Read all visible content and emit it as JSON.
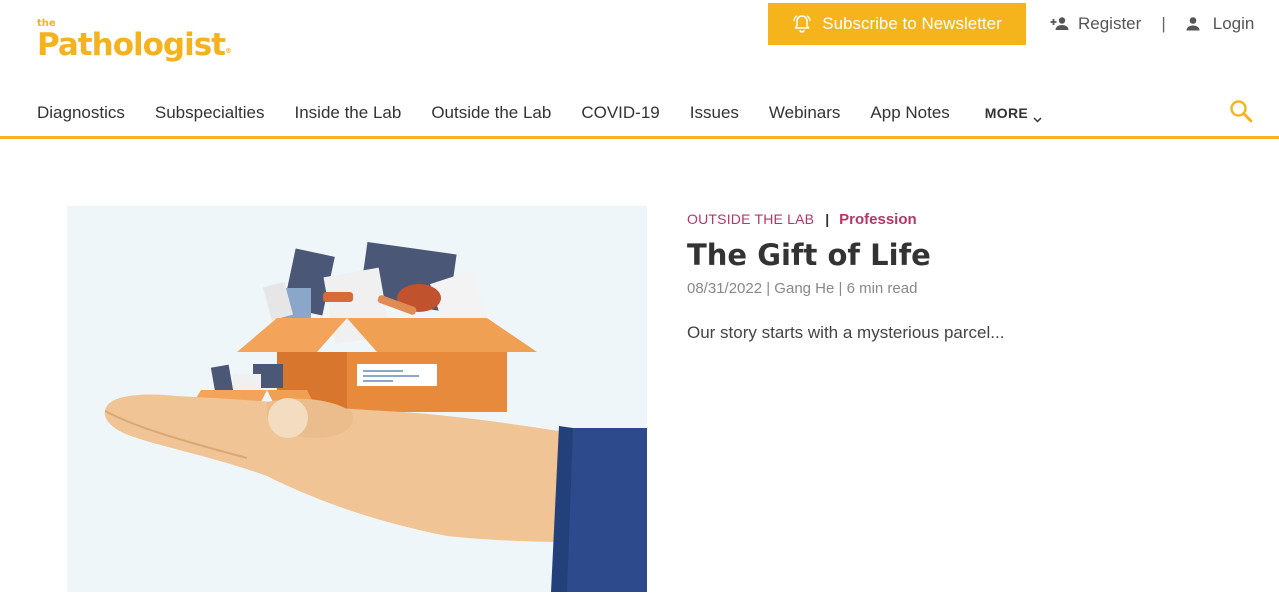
{
  "logo": {
    "the": "the",
    "name": "Pathologist",
    "mark": "®"
  },
  "header": {
    "subscribe_label": "Subscribe to Newsletter",
    "register_label": "Register",
    "separator": "|",
    "login_label": "Login",
    "icons": {
      "subscribe": "bell-icon",
      "register": "add-user-icon",
      "login": "user-icon",
      "search": "search-icon"
    }
  },
  "nav": {
    "items": [
      "Diagnostics",
      "Subspecialties",
      "Inside the Lab",
      "Outside the Lab",
      "COVID-19",
      "Issues",
      "Webinars",
      "App Notes"
    ],
    "more_label": "MORE"
  },
  "article": {
    "section": "OUTSIDE THE LAB",
    "separator": "|",
    "topic": "Profession",
    "title": "The Gift of Life",
    "meta": "08/31/2022 | Gang He | 6 min read",
    "excerpt": "Our story starts with a mysterious parcel..."
  },
  "colors": {
    "accent": "#f5b41c",
    "brand": "#f4b21f",
    "category": "#b2376a",
    "sleeve": "#2c4a8c",
    "box": "#ee9443"
  }
}
